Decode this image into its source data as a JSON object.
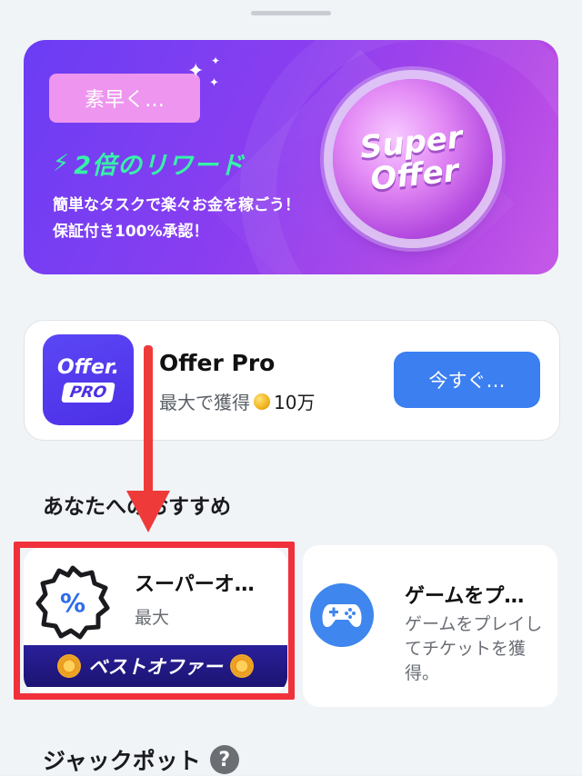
{
  "banner": {
    "quick_button": "素早く…",
    "reward_title": "2倍のリワード",
    "desc_line1": "簡単なタスクで楽々お金を稼ごう！",
    "desc_line2": "保証付き100%承認！",
    "coin_line1": "Super",
    "coin_line2": "Offer",
    "colors": {
      "start": "#6a3df4",
      "end": "#c55ae8",
      "reward": "#37f2a8"
    }
  },
  "offer_pro": {
    "logo_top": "Offer.",
    "logo_bottom": "PRO",
    "title": "Offer Pro",
    "subtitle_prefix": "最大で獲得",
    "subtitle_amount": "10万",
    "button": "今すぐ…",
    "button_color": "#3b7ff0"
  },
  "recommendations": {
    "section_title": "あなたへのおすすめ",
    "items": [
      {
        "title": "スーパーオ…",
        "subtitle": "最大",
        "badge": "ベストオファー",
        "icon": "percent-badge-icon"
      },
      {
        "title": "ゲームをプ…",
        "description": "ゲームをプレイしてチケットを獲得。",
        "icon": "gamepad-icon"
      }
    ]
  },
  "jackpot": {
    "title": "ジャックポット",
    "help": "?"
  },
  "annotation": {
    "color": "#f0313c"
  }
}
